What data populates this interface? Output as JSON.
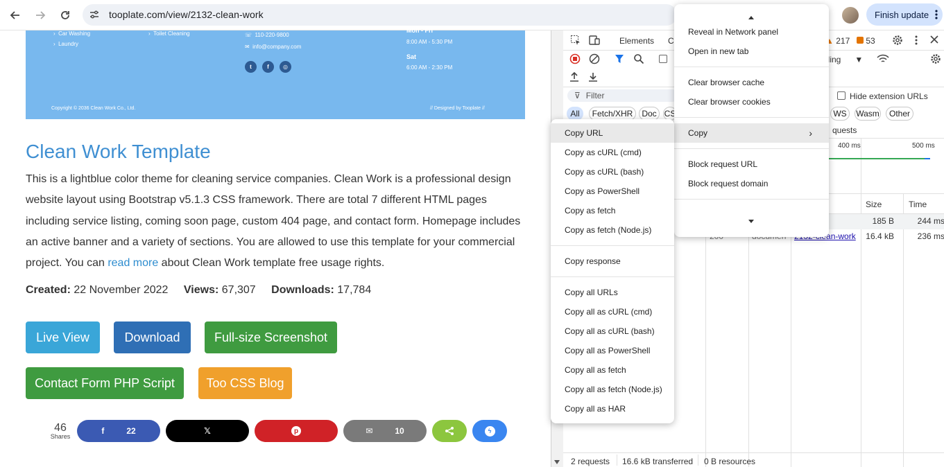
{
  "browser": {
    "url": "tooplate.com/view/2132-clean-work",
    "finish_update_label": "Finish update"
  },
  "banner": {
    "services": [
      "Car Washing",
      "Laundry",
      "Toilet Cleaning"
    ],
    "phone": "110-220-9800",
    "email": "info@company.com",
    "weekday_label": "Mon - Fri",
    "weekday_hours": "8:00 AM - 5:30 PM",
    "sat_label": "Sat",
    "sat_hours": "6:00 AM - 2:30 PM",
    "copyright": "Copyright © 2036 Clean Work Co., Ltd.",
    "designed_by": "// Designed by Tooplate //"
  },
  "page": {
    "title": "Clean Work Template",
    "desc_part1": "This is a lightblue color theme for cleaning service companies. Clean Work is a professional design website layout using Bootstrap v5.1.3 CSS framework. There are total 7 different HTML pages including service listing, coming soon page, custom 404 page, and contact form. Homepage includes an active banner and a variety of sections. You are allowed to use this template for your commercial project. You can ",
    "desc_link": "read more",
    "desc_part2": " about Clean Work template free usage rights.",
    "created_label": "Created:",
    "created_value": "22 November 2022",
    "views_label": "Views:",
    "views_value": "67,307",
    "downloads_label": "Downloads:",
    "downloads_value": "17,784",
    "buttons": {
      "live_view": "Live View",
      "download": "Download",
      "fullsize": "Full-size Screenshot",
      "contact_form": "Contact Form PHP Script",
      "blog": "Too CSS Blog"
    },
    "share": {
      "total": "46",
      "total_label": "Shares",
      "facebook_count": "22",
      "email_count": "10"
    }
  },
  "devtools": {
    "tab_elements": "Elements",
    "tab_partial": "C",
    "warning_count": "217",
    "issue_count": "53",
    "throttling_partial": "ttling",
    "filter_placeholder": "Filter",
    "hide_extension_urls": "Hide extension URLs",
    "chips": [
      "All",
      "Fetch/XHR",
      "Doc",
      "CS",
      "WS",
      "Wasm",
      "Other"
    ],
    "requests_partial": "quests",
    "timeline_400": "400 ms",
    "timeline_500": "500 ms",
    "col_size": "Size",
    "col_time": "Time",
    "rows": [
      {
        "status": "",
        "type": "",
        "name": "",
        "size": "185 B",
        "time": "244 ms"
      },
      {
        "status": "200",
        "type": "documen",
        "name": "2132-clean-work",
        "size": "16.4 kB",
        "time": "236 ms"
      }
    ],
    "status_requests": "2 requests",
    "status_transferred": "16.6 kB transferred",
    "status_resources": "0 B resources"
  },
  "main_menu": {
    "items": [
      "Reveal in Network panel",
      "Open in new tab",
      "Clear browser cache",
      "Clear browser cookies",
      "Copy",
      "Block request URL",
      "Block request domain"
    ]
  },
  "copy_menu": {
    "items": [
      "Copy URL",
      "Copy as cURL (cmd)",
      "Copy as cURL (bash)",
      "Copy as PowerShell",
      "Copy as fetch",
      "Copy as fetch (Node.js)",
      "Copy response",
      "Copy all URLs",
      "Copy all as cURL (cmd)",
      "Copy all as cURL (bash)",
      "Copy all as PowerShell",
      "Copy all as fetch",
      "Copy all as fetch (Node.js)",
      "Copy all as HAR"
    ]
  },
  "colors": {
    "accent_blue": "#3f8fd2",
    "live_view": "#3aa6d8",
    "download": "#2f6fb5",
    "fullsize": "#3f9b40",
    "contact": "#3f9b40",
    "blog": "#f0a02c",
    "facebook": "#3b5ab3",
    "x": "#000000",
    "pinterest": "#d02227",
    "email": "#7a7a7a",
    "share": "#8cc63e",
    "messenger": "#3a86f0"
  }
}
